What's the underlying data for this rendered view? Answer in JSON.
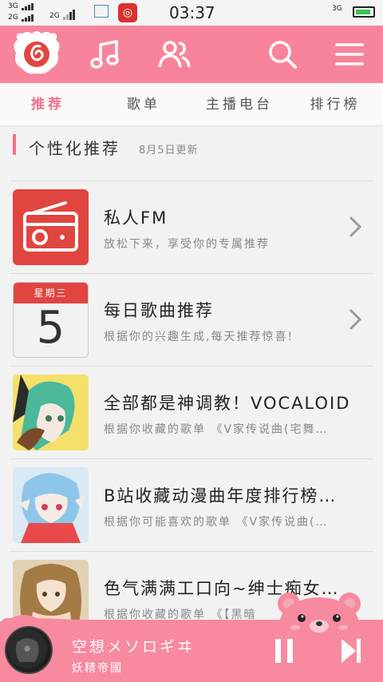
{
  "status_bar": {
    "network_top": "3G",
    "network_bottom": "2G",
    "network_mid": "2G",
    "time": "03:37",
    "network_right": "3G"
  },
  "header": {
    "icons": [
      "logo-icon",
      "music-note-icon",
      "friends-icon",
      "search-icon",
      "menu-icon"
    ]
  },
  "tabs": [
    "推荐",
    "歌单",
    "主播电台",
    "排行榜"
  ],
  "section": {
    "title": "个性化推荐",
    "date": "8月5日更新"
  },
  "list": [
    {
      "title": "私人FM",
      "subtitle": "放松下来，享受你的专属推荐"
    },
    {
      "title": "每日歌曲推荐",
      "subtitle": "根据你的兴趣生成,每天推荐惊喜!",
      "calendar_day": "星期三",
      "calendar_num": "5"
    },
    {
      "title": "全部都是神调教！VOCALOID",
      "subtitle": "根据你收藏的歌单 《V家传说曲(宅舞…"
    },
    {
      "title": "B站收藏动漫曲年度排行榜…",
      "subtitle": "根据你可能喜欢的歌单 《V家传说曲(…"
    },
    {
      "title": "色气满满工口向~绅士痴女…",
      "subtitle": "根据你收藏的歌单 《【黑暗"
    }
  ],
  "player": {
    "song": "空想メソロギヰ",
    "artist": "妖精帝國"
  },
  "colors": {
    "brand_pink": "#f8849b",
    "accent": "#f5708c",
    "netease_red": "#e04540"
  }
}
